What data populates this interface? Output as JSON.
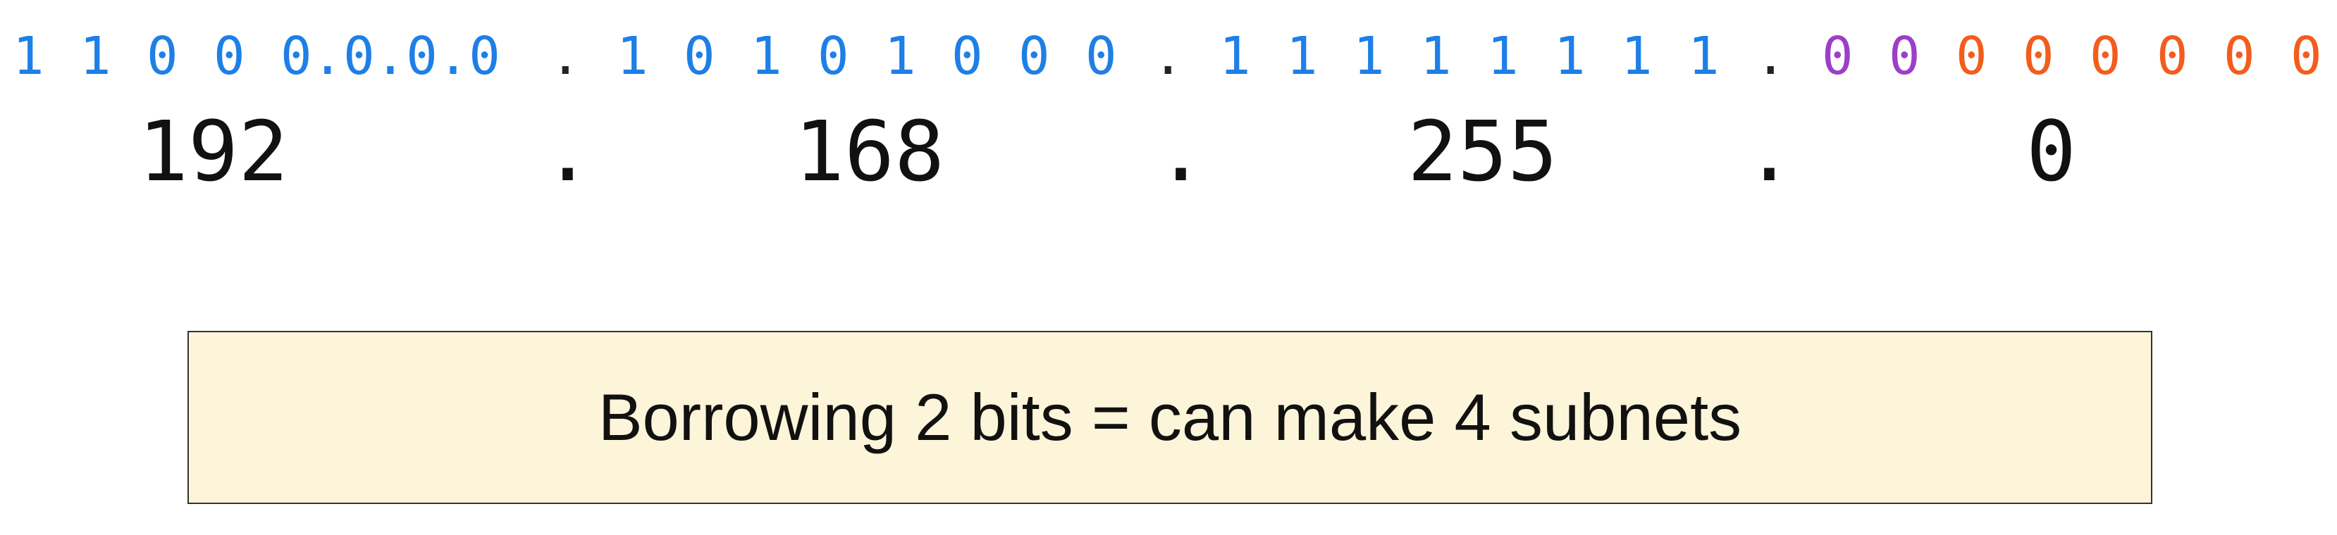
{
  "binary": {
    "octet1": [
      "1",
      "1",
      "0",
      "0",
      "0.0.0.0"
    ],
    "octet2": [
      "1",
      "0",
      "1",
      "0",
      "1",
      "0",
      "0",
      "0"
    ],
    "octet3": [
      "1",
      "1",
      "1",
      "1",
      "1",
      "1",
      "1",
      "1"
    ],
    "octet4_subnet_bits": [
      "0",
      "0"
    ],
    "octet4_host_bits": [
      "0",
      "0",
      "0",
      "0",
      "0",
      "0"
    ],
    "separator": "."
  },
  "decimal": {
    "octets": [
      "192",
      "168",
      "255",
      "0"
    ],
    "separator": "."
  },
  "info_box": {
    "text": "Borrowing 2 bits = can make 4 subnets"
  },
  "colors": {
    "network_bits": "#1e7fe6",
    "borrowed_subnet_bits": "#9b3fc9",
    "host_bits": "#f25d1d",
    "box_fill": "#fdf5d9"
  }
}
